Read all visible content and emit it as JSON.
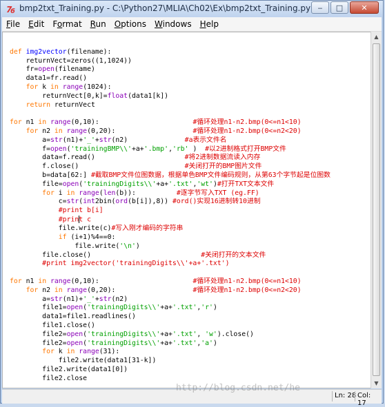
{
  "window": {
    "title": "bmp2txt_Training.py - C:\\Python27\\MLIA\\Ch02\\Ex\\bmp2txt_Training.py"
  },
  "menu": [
    {
      "key": "F",
      "rest": "ile"
    },
    {
      "key": "E",
      "rest": "dit"
    },
    {
      "key": "",
      "pre": "F",
      "key2": "o",
      "rest": "rmat"
    },
    {
      "key": "R",
      "rest": "un"
    },
    {
      "key": "O",
      "rest": "ptions"
    },
    {
      "key": "W",
      "rest": "indows"
    },
    {
      "key": "H",
      "rest": "elp"
    }
  ],
  "status": {
    "line": "Ln: 28",
    "col": "Col: 17"
  },
  "watermark": "http://blog.csdn.net/he",
  "code": [
    [],
    [
      [
        "kw",
        "def "
      ],
      [
        "fn",
        "img2vector"
      ],
      [
        "",
        "(filename):"
      ]
    ],
    [
      [
        "",
        "    returnVect=zeros((1,1024))"
      ]
    ],
    [
      [
        "",
        "    fr="
      ],
      [
        "bi",
        "open"
      ],
      [
        "",
        "(filename)"
      ]
    ],
    [
      [
        "",
        "    data1=fr.read()"
      ]
    ],
    [
      [
        "kw",
        "    for "
      ],
      [
        "",
        "k "
      ],
      [
        "kw",
        "in "
      ],
      [
        "bi",
        "range"
      ],
      [
        "",
        "(1024):"
      ]
    ],
    [
      [
        "",
        "        returnVect[0,k]="
      ],
      [
        "bi",
        "float"
      ],
      [
        "",
        "(data1[k])"
      ]
    ],
    [
      [
        "kw",
        "    return "
      ],
      [
        "",
        "returnVect"
      ]
    ],
    [],
    [
      [
        "kw",
        "for "
      ],
      [
        "",
        "n1 "
      ],
      [
        "kw",
        "in "
      ],
      [
        "bi",
        "range"
      ],
      [
        "",
        "(0,10):                       "
      ],
      [
        "cm",
        "#循环处理n1-n2.bmp(0<=n1<10)"
      ]
    ],
    [
      [
        "kw",
        "    for "
      ],
      [
        "",
        "n2 "
      ],
      [
        "kw",
        "in "
      ],
      [
        "bi",
        "range"
      ],
      [
        "",
        "(0,20):                   "
      ],
      [
        "cm",
        "#循环处理n1-n2.bmp(0<=n2<20)"
      ]
    ],
    [
      [
        "",
        "        a="
      ],
      [
        "bi",
        "str"
      ],
      [
        "",
        "(n1)+"
      ],
      [
        "str",
        "'_'"
      ],
      [
        "",
        "+"
      ],
      [
        "bi",
        "str"
      ],
      [
        "",
        "(n2)              "
      ],
      [
        "cm",
        "#a表示文件名"
      ]
    ],
    [
      [
        "",
        "        f="
      ],
      [
        "bi",
        "open"
      ],
      [
        "",
        "("
      ],
      [
        "str",
        "'trainingBMP\\\\'"
      ],
      [
        "",
        "+a+"
      ],
      [
        "str",
        "'.bmp'"
      ],
      [
        "",
        ","
      ],
      [
        "str",
        "'rb'"
      ],
      [
        "",
        " )  "
      ],
      [
        "cm",
        "#以2进制格式打开BMP文件"
      ]
    ],
    [
      [
        "",
        "        data=f.read()                      "
      ],
      [
        "cm",
        "#将2进制数据流读入内存"
      ]
    ],
    [
      [
        "",
        "        f.close()                          "
      ],
      [
        "cm",
        "#关闭打开的BMP图片文件"
      ]
    ],
    [
      [
        "",
        "        b=data[62:] "
      ],
      [
        "cm",
        "#截取BMP文件位图数据，根据单色BMP文件编码规则，从第63个字节起是位图数"
      ]
    ],
    [
      [
        "",
        "        file="
      ],
      [
        "bi",
        "open"
      ],
      [
        "",
        "("
      ],
      [
        "str",
        "'trainingDigits\\\\'"
      ],
      [
        "",
        "+a+"
      ],
      [
        "str",
        "'.txt'"
      ],
      [
        "",
        ","
      ],
      [
        "str",
        "'wt'"
      ],
      [
        "",
        ")"
      ],
      [
        "cm",
        "#打开TXT文本文件"
      ]
    ],
    [
      [
        "kw",
        "        for "
      ],
      [
        "",
        "i "
      ],
      [
        "kw",
        "in "
      ],
      [
        "bi",
        "range"
      ],
      [
        "",
        "("
      ],
      [
        "bi",
        "len"
      ],
      [
        "",
        "(b)):          "
      ],
      [
        "cm",
        "#逐字节写入TXT (eg.FF)"
      ]
    ],
    [
      [
        "",
        "            c="
      ],
      [
        "bi",
        "str"
      ],
      [
        "",
        "("
      ],
      [
        "bi",
        "int"
      ],
      [
        "",
        "2bin("
      ],
      [
        "bi",
        "ord"
      ],
      [
        "",
        "(b[i]),8)) "
      ],
      [
        "cm",
        "#ord()实现16进制转10进制"
      ]
    ],
    [
      [
        "cm",
        "            #print b[i]"
      ]
    ],
    [
      [
        "cm",
        "            #prin"
      ],
      [
        "caret",
        ""
      ],
      [
        "cm",
        "t c"
      ]
    ],
    [
      [
        "",
        "            file.write(c)"
      ],
      [
        "cm",
        "#写入刚才编码的字符串"
      ]
    ],
    [
      [
        "kw",
        "            if "
      ],
      [
        "",
        "(i+1)%4==0:"
      ]
    ],
    [
      [
        "",
        "                file.write("
      ],
      [
        "str",
        "'\\n'"
      ],
      [
        "",
        ")"
      ]
    ],
    [
      [
        "",
        "        file.close()                           "
      ],
      [
        "cm",
        "#关闭打开的文本文件"
      ]
    ],
    [
      [
        "cm",
        "        #print img2vector('trainingDigits\\\\'+a+'.txt')"
      ]
    ],
    [],
    [
      [
        "kw",
        "for "
      ],
      [
        "",
        "n1 "
      ],
      [
        "kw",
        "in "
      ],
      [
        "bi",
        "range"
      ],
      [
        "",
        "(0,10):                       "
      ],
      [
        "cm",
        "#循环处理n1-n2.bmp(0<=n1<10)"
      ]
    ],
    [
      [
        "kw",
        "    for "
      ],
      [
        "",
        "n2 "
      ],
      [
        "kw",
        "in "
      ],
      [
        "bi",
        "range"
      ],
      [
        "",
        "(0,20):                   "
      ],
      [
        "cm",
        "#循环处理n1-n2.bmp(0<=n2<20)"
      ]
    ],
    [
      [
        "",
        "        a="
      ],
      [
        "bi",
        "str"
      ],
      [
        "",
        "(n1)+"
      ],
      [
        "str",
        "'_'"
      ],
      [
        "",
        "+"
      ],
      [
        "bi",
        "str"
      ],
      [
        "",
        "(n2)"
      ]
    ],
    [
      [
        "",
        "        file1="
      ],
      [
        "bi",
        "open"
      ],
      [
        "",
        "("
      ],
      [
        "str",
        "'trainingDigits\\\\'"
      ],
      [
        "",
        "+a+"
      ],
      [
        "str",
        "'.txt'"
      ],
      [
        "",
        ","
      ],
      [
        "str",
        "'r'"
      ],
      [
        "",
        ")"
      ]
    ],
    [
      [
        "",
        "        data1=file1.readlines()"
      ]
    ],
    [
      [
        "",
        "        file1.close()"
      ]
    ],
    [
      [
        "",
        "        file2="
      ],
      [
        "bi",
        "open"
      ],
      [
        "",
        "("
      ],
      [
        "str",
        "'trainingDigits\\\\'"
      ],
      [
        "",
        "+a+"
      ],
      [
        "str",
        "'.txt'"
      ],
      [
        "",
        ", "
      ],
      [
        "str",
        "'w'"
      ],
      [
        "",
        ").close()"
      ]
    ],
    [
      [
        "",
        "        file2="
      ],
      [
        "bi",
        "open"
      ],
      [
        "",
        "("
      ],
      [
        "str",
        "'trainingDigits\\\\'"
      ],
      [
        "",
        "+a+"
      ],
      [
        "str",
        "'.txt'"
      ],
      [
        "",
        ","
      ],
      [
        "str",
        "'a'"
      ],
      [
        "",
        ")"
      ]
    ],
    [
      [
        "kw",
        "        for "
      ],
      [
        "",
        "k "
      ],
      [
        "kw",
        "in "
      ],
      [
        "bi",
        "range"
      ],
      [
        "",
        "(31):"
      ]
    ],
    [
      [
        "",
        "            file2.write(data1[31-k])"
      ]
    ],
    [
      [
        "",
        "        file2.write(data1[0])"
      ]
    ],
    [
      [
        "",
        "        file2.close"
      ]
    ]
  ]
}
